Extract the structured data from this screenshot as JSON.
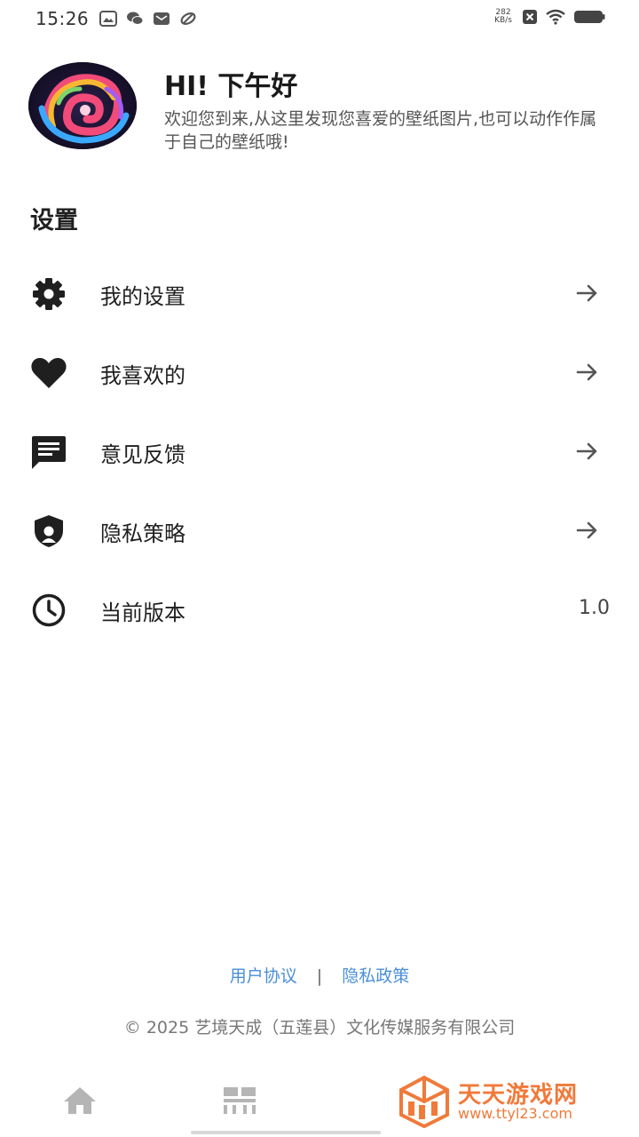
{
  "status_bar": {
    "time": "15:26",
    "net_speed_value": "282",
    "net_speed_unit": "KB/s",
    "left_icons": [
      "gallery-icon",
      "wechat-icon",
      "mail-icon",
      "link-icon"
    ],
    "right_icons": [
      "close-notification-icon",
      "wifi-icon",
      "battery-icon"
    ]
  },
  "header": {
    "greeting": "HI! 下午好",
    "intro": "欢迎您到来,从这里发现您喜爱的壁纸图片,也可以动作作属于自己的壁纸哦!"
  },
  "settings": {
    "title": "设置",
    "items": [
      {
        "label": "我的设置",
        "icon": "gear-icon"
      },
      {
        "label": "我喜欢的",
        "icon": "heart-icon"
      },
      {
        "label": "意见反馈",
        "icon": "feedback-icon"
      },
      {
        "label": "隐私策略",
        "icon": "shield-icon"
      },
      {
        "label": "当前版本",
        "icon": "clock-icon",
        "value": "1.0"
      }
    ]
  },
  "footer": {
    "user_agreement": "用户协议",
    "separator": "|",
    "privacy_policy": "隐私政策",
    "copyright": "© 2025 艺境天成（五莲县）文化传媒服务有限公司"
  },
  "bottom_nav": {
    "items": [
      "home-icon",
      "grid-icon"
    ]
  },
  "watermark": {
    "title": "天天游戏网",
    "url": "www.ttyl23.com"
  },
  "colors": {
    "link": "#4a8fd8",
    "icon": "#1f1f1f",
    "nav_icon": "#b5b5b5",
    "watermark": "#f07a3a"
  }
}
